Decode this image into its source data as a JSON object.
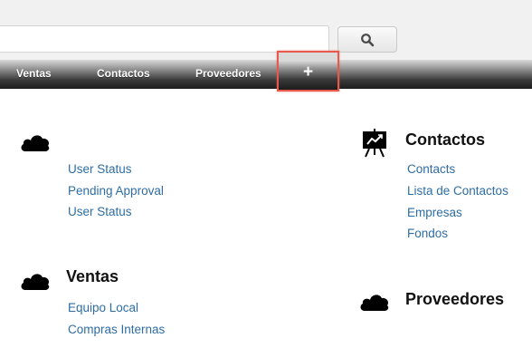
{
  "search": {
    "value": "",
    "placeholder": "",
    "button_icon": "search-icon"
  },
  "nav": {
    "items": [
      {
        "label": "Ventas"
      },
      {
        "label": "Contactos"
      },
      {
        "label": "Proveedores"
      }
    ],
    "add_label": "+"
  },
  "sections": {
    "first": {
      "title": "",
      "icon": "cloud-icon",
      "links": [
        "User Status",
        "Pending Approval",
        "User Status"
      ]
    },
    "ventas": {
      "title": "Ventas",
      "icon": "cloud-icon",
      "links": [
        "Equipo Local",
        "Compras Internas"
      ]
    },
    "contactos": {
      "title": "Contactos",
      "icon": "presentation-chart-icon",
      "links": [
        "Contacts",
        "Lista de Contactos",
        "Empresas",
        "Fondos"
      ]
    },
    "proveedores": {
      "title": "Proveedores",
      "icon": "cloud-icon",
      "links": []
    }
  }
}
